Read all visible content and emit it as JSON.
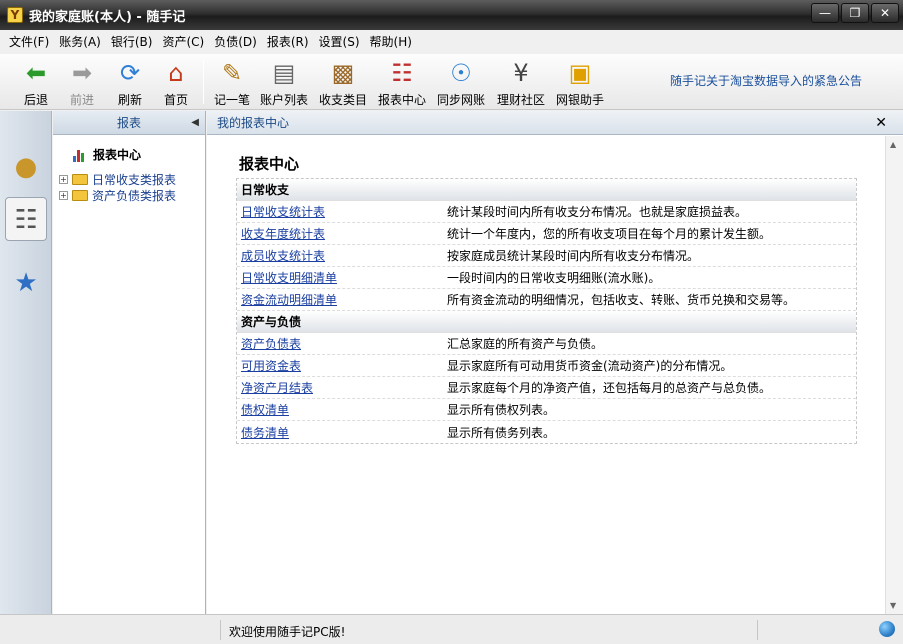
{
  "window": {
    "title": "我的家庭账(本人) - 随手记",
    "icon_letter": "Y"
  },
  "menu": [
    "文件(F)",
    "账务(A)",
    "银行(B)",
    "资产(C)",
    "负债(D)",
    "报表(R)",
    "设置(S)",
    "帮助(H)"
  ],
  "toolbar": {
    "back": "后退",
    "forward": "前进",
    "refresh": "刷新",
    "home": "首页",
    "record": "记一笔",
    "accounts": "账户列表",
    "categories": "收支类目",
    "reports": "报表中心",
    "sync": "同步网账",
    "community": "理财社区",
    "helper": "网银助手",
    "notice": "随手记关于淘宝数据导入的紧急公告"
  },
  "left_panel": {
    "header": "报表",
    "root": "报表中心",
    "nodes": [
      "日常收支类报表",
      "资产负债类报表"
    ]
  },
  "main": {
    "tab_title": "我的报表中心",
    "page_title": "报表中心",
    "sections": [
      {
        "name": "日常收支",
        "rows": [
          {
            "link": "日常收支统计表",
            "desc": "统计某段时间内所有收支分布情况。也就是家庭损益表。"
          },
          {
            "link": "收支年度统计表",
            "desc": "统计一个年度内，您的所有收支项目在每个月的累计发生额。"
          },
          {
            "link": "成员收支统计表",
            "desc": "按家庭成员统计某段时间内所有收支分布情况。"
          },
          {
            "link": "日常收支明细清单",
            "desc": "一段时间内的日常收支明细账(流水账)。"
          },
          {
            "link": "资金流动明细清单",
            "desc": "所有资金流动的明细情况，包括收支、转账、货币兑换和交易等。"
          }
        ]
      },
      {
        "name": "资产与负债",
        "rows": [
          {
            "link": "资产负债表",
            "desc": "汇总家庭的所有资产与负债。"
          },
          {
            "link": "可用资金表",
            "desc": "显示家庭所有可动用货币资金(流动资产)的分布情况。"
          },
          {
            "link": "净资产月结表",
            "desc": "显示家庭每个月的净资产值，还包括每月的总资产与总负债。"
          },
          {
            "link": "债权清单",
            "desc": "显示所有债权列表。"
          },
          {
            "link": "债务清单",
            "desc": "显示所有债务列表。"
          }
        ]
      }
    ]
  },
  "status": {
    "text": "欢迎使用随手记PC版!"
  }
}
